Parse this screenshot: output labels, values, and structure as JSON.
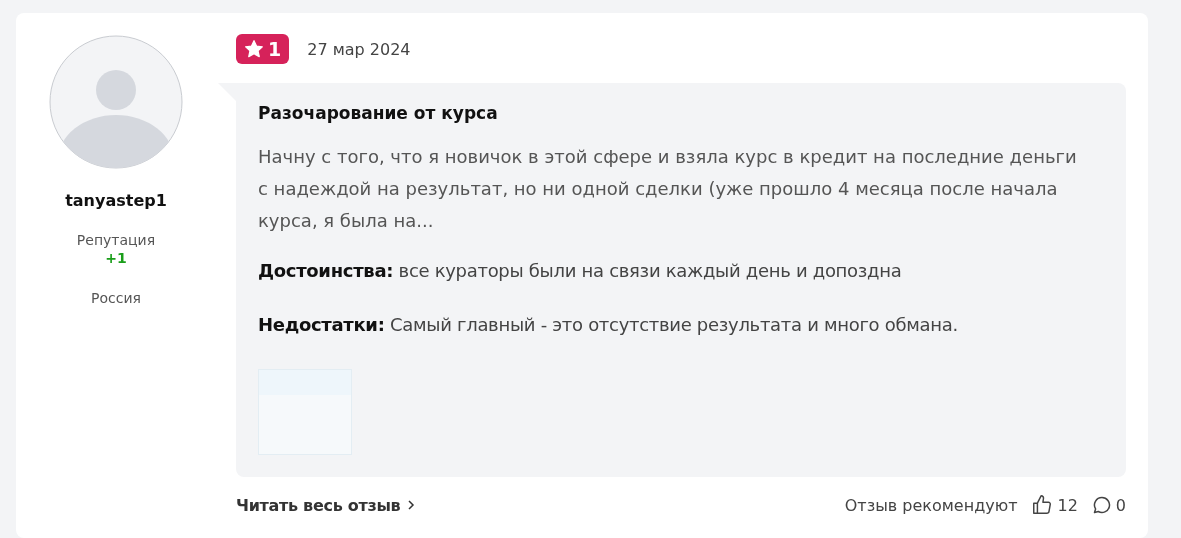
{
  "author": {
    "username": "tanyastep1",
    "reputation_label": "Репутация",
    "reputation": "+1",
    "country": "Россия"
  },
  "review": {
    "rating": "1",
    "date": "27 мар 2024",
    "title": "Разочарование от курса",
    "excerpt": "Начну с того, что я новичок в этой сфере и взяла курс в кредит на последние деньги с надеждой на результат, но ни одной сделки (уже прошло 4 месяца после начала курса, я была на...",
    "pros": "**Достоинства:** все кураторы были на связи каждый день и допоздна",
    "cons": "**Недостатки:** Самый главный - это отсутствие результата и много обмана."
  },
  "footer": {
    "read_more": "Читать весь отзыв",
    "recommend_label": "Отзыв рекомендуют",
    "likes": "12",
    "comments": "0"
  }
}
